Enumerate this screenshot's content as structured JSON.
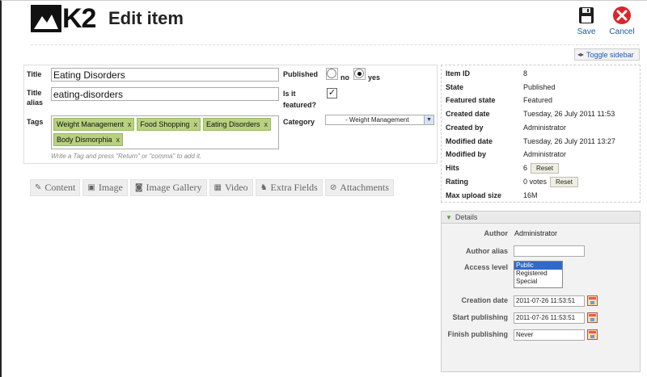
{
  "header": {
    "logo_text": "K2",
    "title": "Edit item",
    "save_label": "Save",
    "cancel_label": "Cancel"
  },
  "toggle_sidebar_label": "Toggle sidebar",
  "form": {
    "title_label": "Title",
    "title_value": "Eating Disorders",
    "alias_label_1": "Title",
    "alias_label_2": "alias",
    "alias_value": "eating-disorders",
    "tags_label": "Tags",
    "tags": [
      "Weight Management",
      "Food Shopping",
      "Eating Disorders",
      "Body Dismorphia"
    ],
    "tag_remove": "x",
    "tags_hint": "Write a Tag and press \"Return\" or \"comma\" to add it.",
    "published_label": "Published",
    "published_no": "no",
    "published_yes": "yes",
    "featured_label_1": "Is it",
    "featured_label_2": "featured?",
    "category_label": "Category",
    "category_value": "- Weight Management"
  },
  "tabs": [
    {
      "label": "Content",
      "icon": "edit-icon"
    },
    {
      "label": "Image",
      "icon": "image-icon"
    },
    {
      "label": "Image Gallery",
      "icon": "camera-icon"
    },
    {
      "label": "Video",
      "icon": "film-icon"
    },
    {
      "label": "Extra Fields",
      "icon": "bicycle-icon"
    },
    {
      "label": "Attachments",
      "icon": "paperclip-icon"
    }
  ],
  "info": {
    "item_id_label": "Item ID",
    "item_id": "8",
    "state_label": "State",
    "state": "Published",
    "featured_state_label": "Featured state",
    "featured_state": "Featured",
    "created_date_label": "Created date",
    "created_date": "Tuesday, 26 July 2011 11:53",
    "created_by_label": "Created by",
    "created_by": "Administrator",
    "modified_date_label": "Modified date",
    "modified_date": "Tuesday, 26 July 2011 13:27",
    "modified_by_label": "Modified by",
    "modified_by": "Administrator",
    "hits_label": "Hits",
    "hits": "6",
    "hits_reset": "Reset",
    "rating_label": "Rating",
    "rating": "0 votes",
    "rating_reset": "Reset",
    "max_upload_label": "Max upload size",
    "max_upload": "16M"
  },
  "details": {
    "header": "Details",
    "author_label": "Author",
    "author": "Administrator",
    "author_alias_label": "Author alias",
    "author_alias": "",
    "access_label": "Access level",
    "access_options": [
      "Public",
      "Registered",
      "Special"
    ],
    "creation_label": "Creation date",
    "creation": "2011-07-26 11:53:51",
    "start_label": "Start publishing",
    "start": "2011-07-26 11:53:51",
    "finish_label": "Finish publishing",
    "finish": "Never"
  },
  "colors": {
    "tag_bg": "#b7d17e",
    "link_blue": "#1b57b1",
    "cancel_red": "#d9262c",
    "selected_blue": "#3169c6"
  }
}
